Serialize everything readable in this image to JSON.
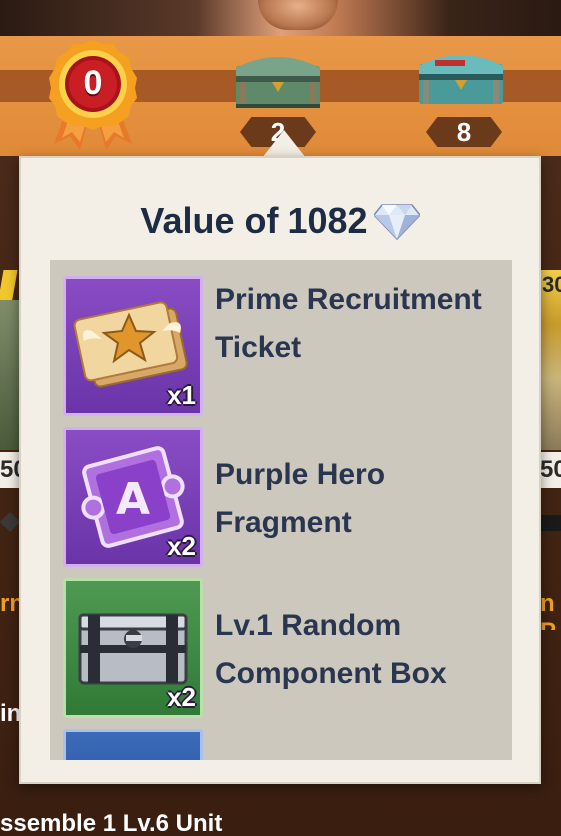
{
  "reward_bar": {
    "medal": {
      "value": "0",
      "icon": "medal-icon"
    },
    "chests": [
      {
        "icon": "green-chest-icon",
        "count": "2"
      },
      {
        "icon": "teal-chest-icon",
        "count": "8"
      }
    ]
  },
  "popup": {
    "title_prefix": "Value of",
    "title_value": "1082",
    "currency_icon": "diamond-icon",
    "items": [
      {
        "name": "Prime Recruitment Ticket",
        "quantity": "x1",
        "icon": "recruitment-ticket-icon",
        "rarity_color": "#7a3fbb"
      },
      {
        "name": "Purple Hero Fragment",
        "quantity": "x2",
        "icon": "hero-fragment-icon",
        "rarity_color": "#7a3fbb"
      },
      {
        "name": "Lv.1 Random Component Box",
        "quantity": "x2",
        "icon": "component-box-icon",
        "rarity_color": "#3f8a44"
      },
      {
        "name": "",
        "quantity": "",
        "icon": "item-icon",
        "rarity_color": "#3a5aa8"
      }
    ]
  },
  "background": {
    "left_numbers": "50",
    "right_numbers": "50",
    "left_badge": "",
    "right_badge": "30",
    "left_text": "rn",
    "right_text": "n P",
    "left_text2": "in",
    "bottom_text": "ssemble 1 Lv.6 Unit"
  }
}
